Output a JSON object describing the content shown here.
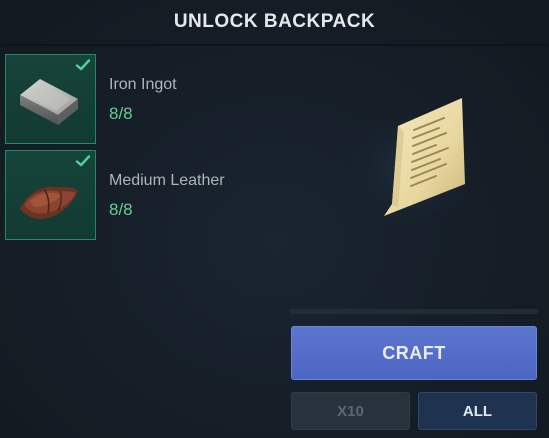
{
  "header": {
    "title": "UNLOCK BACKPACK"
  },
  "ingredients": [
    {
      "name": "Iron Ingot",
      "count": "8/8",
      "icon": "iron-ingot-icon",
      "complete": true
    },
    {
      "name": "Medium Leather",
      "count": "8/8",
      "icon": "leather-icon",
      "complete": true
    }
  ],
  "preview": {
    "icon": "recipe-scroll-icon"
  },
  "progress": {
    "value": 0
  },
  "actions": {
    "craft_label": "CRAFT",
    "x10_label": "X10",
    "all_label": "ALL"
  },
  "colors": {
    "background": "#17202a",
    "ingredient_border": "#1f8a64",
    "count_complete": "#5fd08f",
    "craft_button": "#5670c9",
    "x10_disabled": "#27323d",
    "all_button": "#1f3350"
  }
}
